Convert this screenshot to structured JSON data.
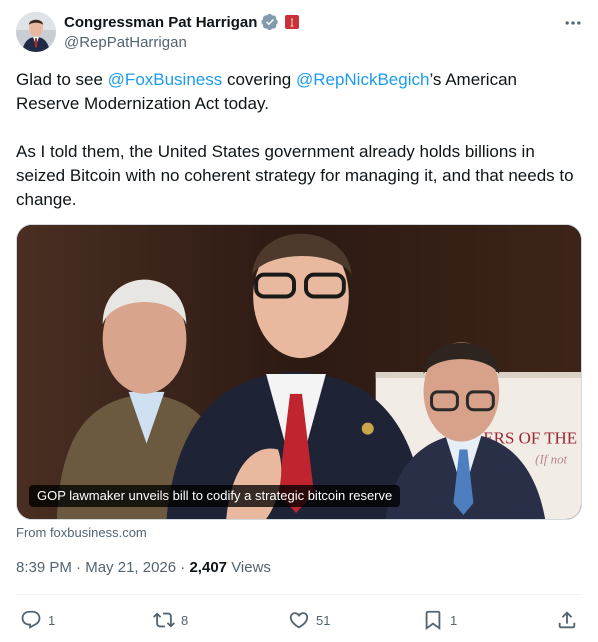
{
  "author": {
    "display_name": "Congressman Pat Harrigan",
    "handle": "@RepPatHarrigan",
    "verified_icon": "verified-badge-icon",
    "affiliation_icon": "house-seal-icon"
  },
  "tweet": {
    "paragraph1": {
      "before": "Glad to see ",
      "mention1": "@FoxBusiness",
      "middle": " covering ",
      "mention2": "@RepNickBegich",
      "after": "’s American Reserve Modernization Act today."
    },
    "paragraph2": "As I told them, the United States government already holds billions in seized Bitcoin with no coherent strategy for managing it, and that needs to change."
  },
  "media": {
    "caption": "GOP lawmaker unveils bill to codify a strategic bitcoin reserve",
    "backdrop_text": "ERS OF THE D",
    "source": "From foxbusiness.com"
  },
  "meta": {
    "time": "8:39 PM",
    "separator": "·",
    "date": "May 21, 2026",
    "views_count": "2,407",
    "views_label": "Views"
  },
  "actions": {
    "replies": "1",
    "reposts": "8",
    "likes": "51",
    "bookmarks": "1"
  },
  "colors": {
    "accent": "#1d9bf0",
    "text": "#0f1419",
    "secondary": "#536471",
    "divider": "#eff3f4"
  }
}
